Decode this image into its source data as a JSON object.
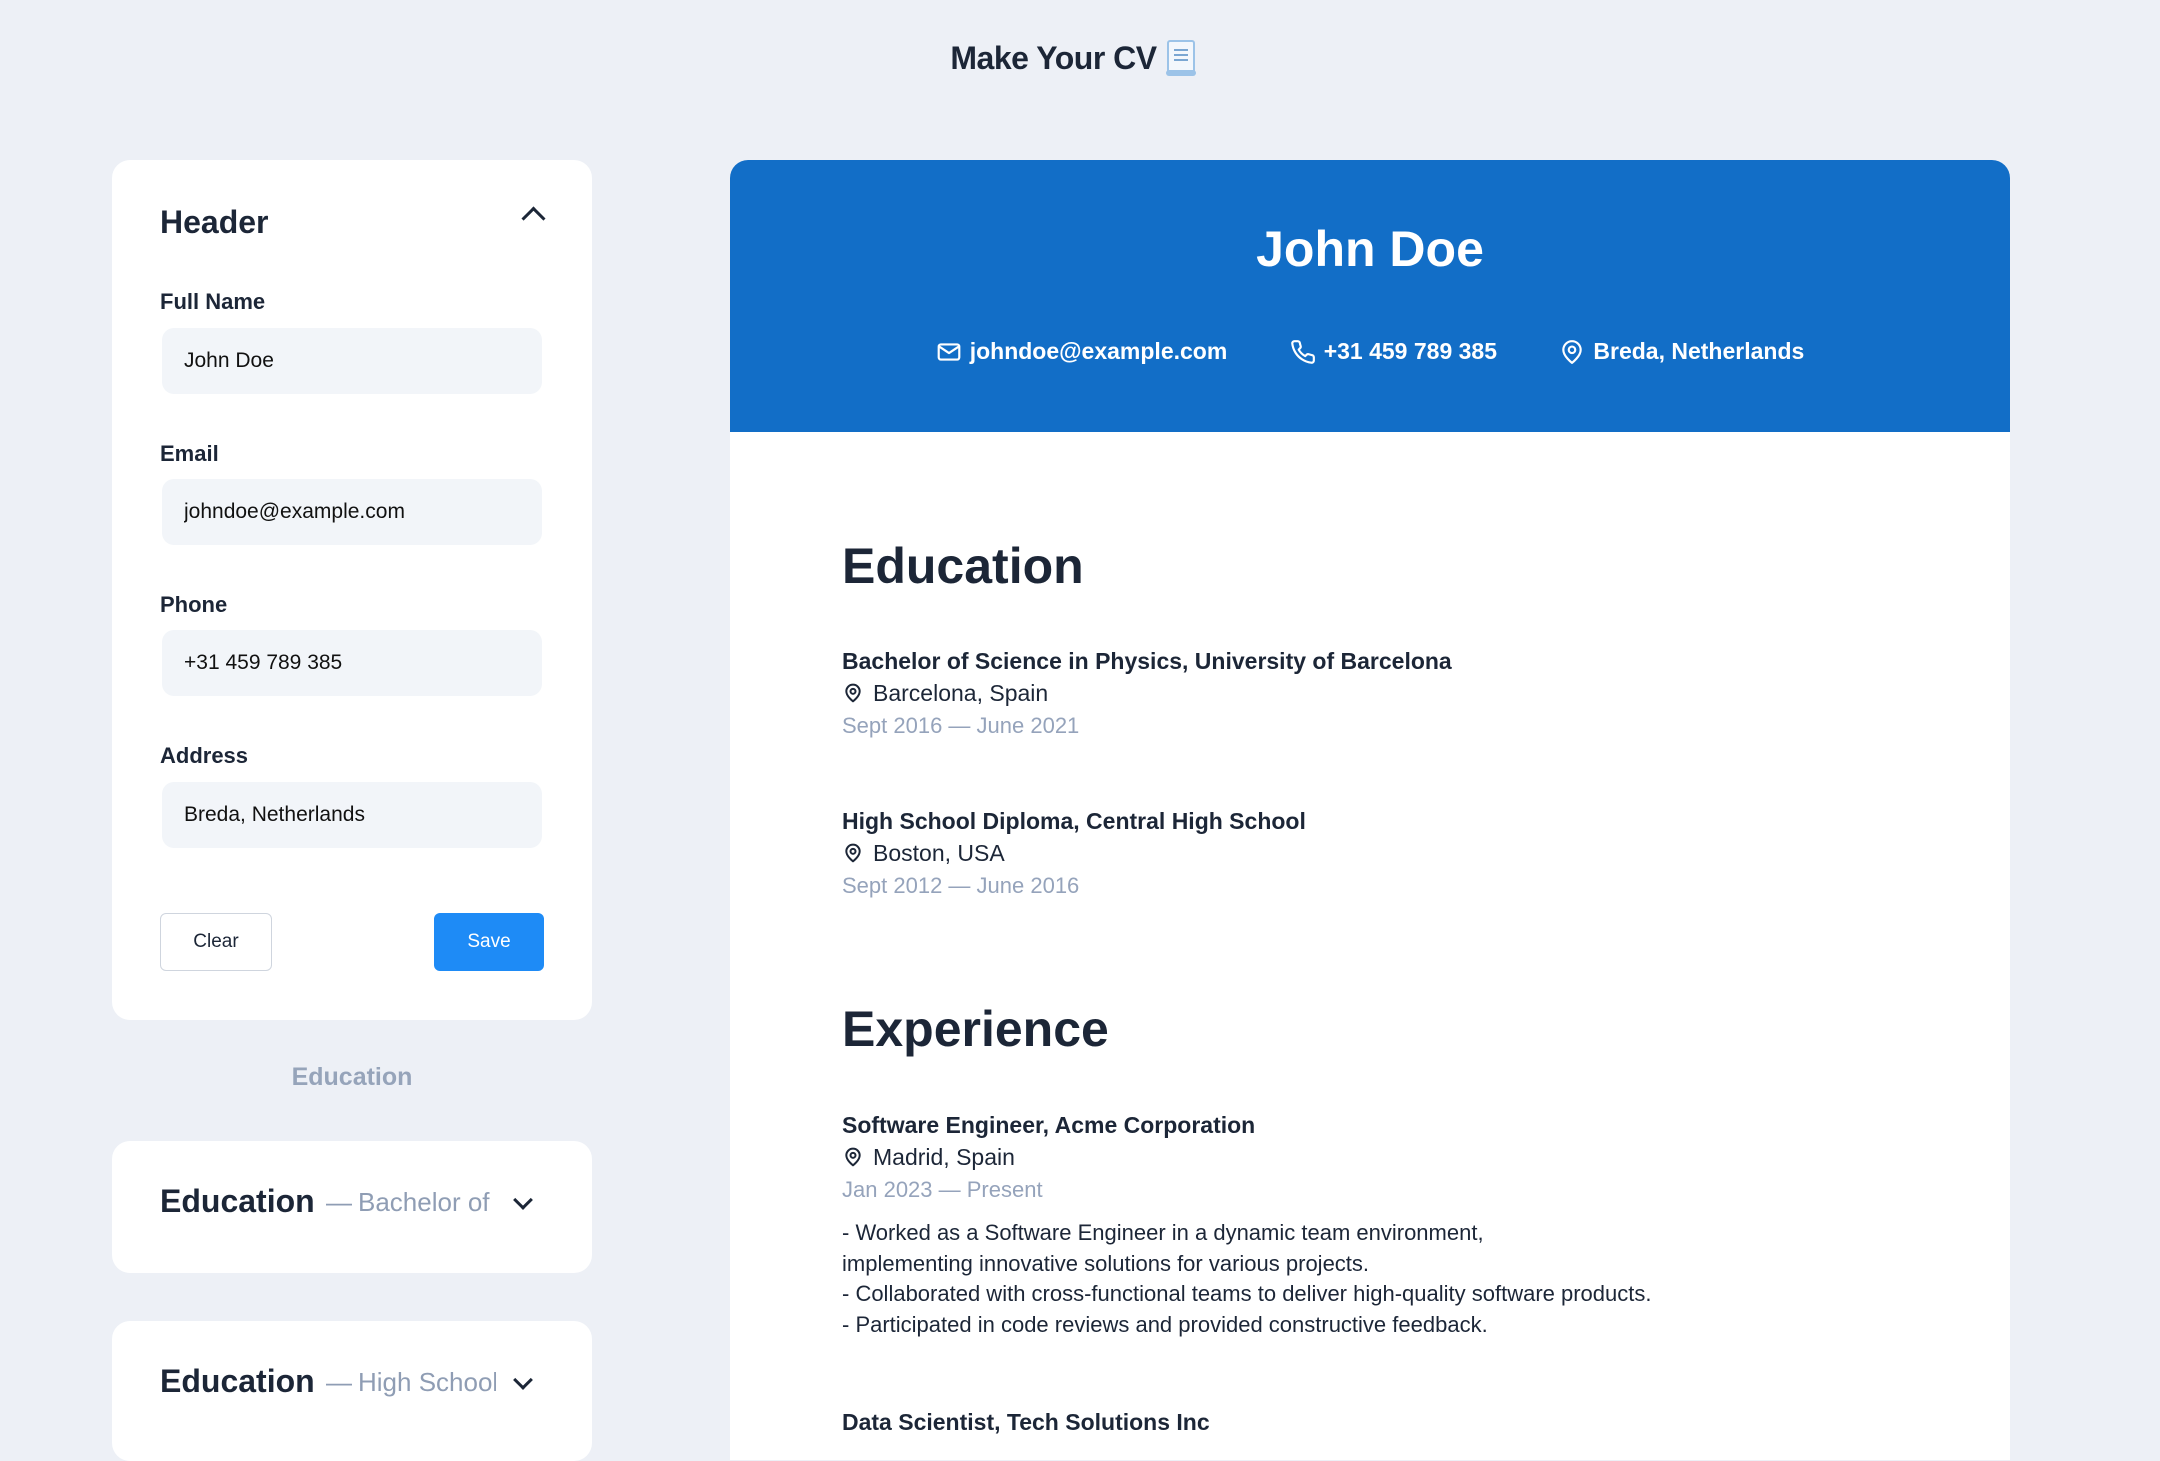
{
  "app": {
    "title": "Make Your CV",
    "title_icon": "page-facing-up-emoji"
  },
  "header_form": {
    "title": "Header",
    "fields": {
      "full_name": {
        "label": "Full Name",
        "value": "John Doe"
      },
      "email": {
        "label": "Email",
        "value": "johndoe@example.com"
      },
      "phone": {
        "label": "Phone",
        "value": "+31 459 789 385"
      },
      "address": {
        "label": "Address",
        "value": "Breda, Netherlands"
      }
    },
    "clear_label": "Clear",
    "save_label": "Save"
  },
  "education_section": {
    "label": "Education",
    "items": [
      {
        "title": "Education",
        "separator": "—",
        "subtitle": "Bachelor of Science in Physics"
      },
      {
        "title": "Education",
        "separator": "—",
        "subtitle": "High School Diploma"
      }
    ]
  },
  "cv": {
    "name": "John Doe",
    "email": "johndoe@example.com",
    "phone": "+31 459 789 385",
    "address": "Breda, Netherlands",
    "education_title": "Education",
    "education": [
      {
        "title": "Bachelor of Science in Physics, University of Barcelona",
        "location": "Barcelona, Spain",
        "dates": "Sept 2016 — June 2021"
      },
      {
        "title": "High School Diploma, Central High School",
        "location": "Boston, USA",
        "dates": "Sept 2012 — June 2016"
      }
    ],
    "experience_title": "Experience",
    "experience": [
      {
        "title": "Software Engineer, Acme Corporation",
        "location": "Madrid, Spain",
        "dates": "Jan 2023 — Present",
        "description": "- Worked as a Software Engineer in a dynamic team environment,\nimplementing innovative solutions for various projects.\n- Collaborated with cross-functional teams to deliver high-quality software products.\n- Participated in code reviews and provided constructive feedback."
      },
      {
        "title": "Data Scientist, Tech Solutions Inc"
      }
    ]
  },
  "colors": {
    "accent": "#126ec7",
    "primary_button": "#1e8bf6",
    "background": "#edf0f6",
    "muted_text": "#95a3bb"
  }
}
